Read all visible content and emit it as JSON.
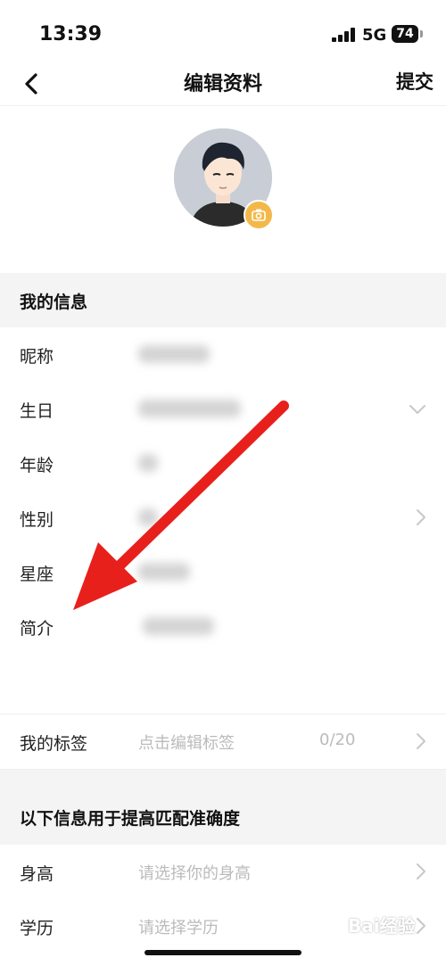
{
  "status_bar": {
    "time": "13:39",
    "network": "5G",
    "battery": "74"
  },
  "nav": {
    "title": "编辑资料",
    "submit_label": "提交",
    "back_icon": "chevron-left-icon"
  },
  "profile": {
    "avatar_icon": "avatar-illustration",
    "camera_icon": "camera-icon",
    "camera_color": "#f2b94a"
  },
  "my_info": {
    "heading": "我的信息",
    "rows": [
      {
        "label": "昵称"
      },
      {
        "label": "生日"
      },
      {
        "label": "年龄"
      },
      {
        "label": "性别"
      },
      {
        "label": "星座"
      },
      {
        "label": "简介"
      }
    ]
  },
  "tags": {
    "label": "我的标签",
    "placeholder": "点击编辑标签",
    "count": "0/20"
  },
  "match_info": {
    "heading": "以下信息用于提高匹配准确度",
    "rows": [
      {
        "label": "身高",
        "placeholder": "请选择你的身高"
      },
      {
        "label": "学历",
        "placeholder": "请选择学历"
      }
    ]
  },
  "annotation": {
    "arrow_color": "#e8201c"
  },
  "watermark": "Bai经验"
}
